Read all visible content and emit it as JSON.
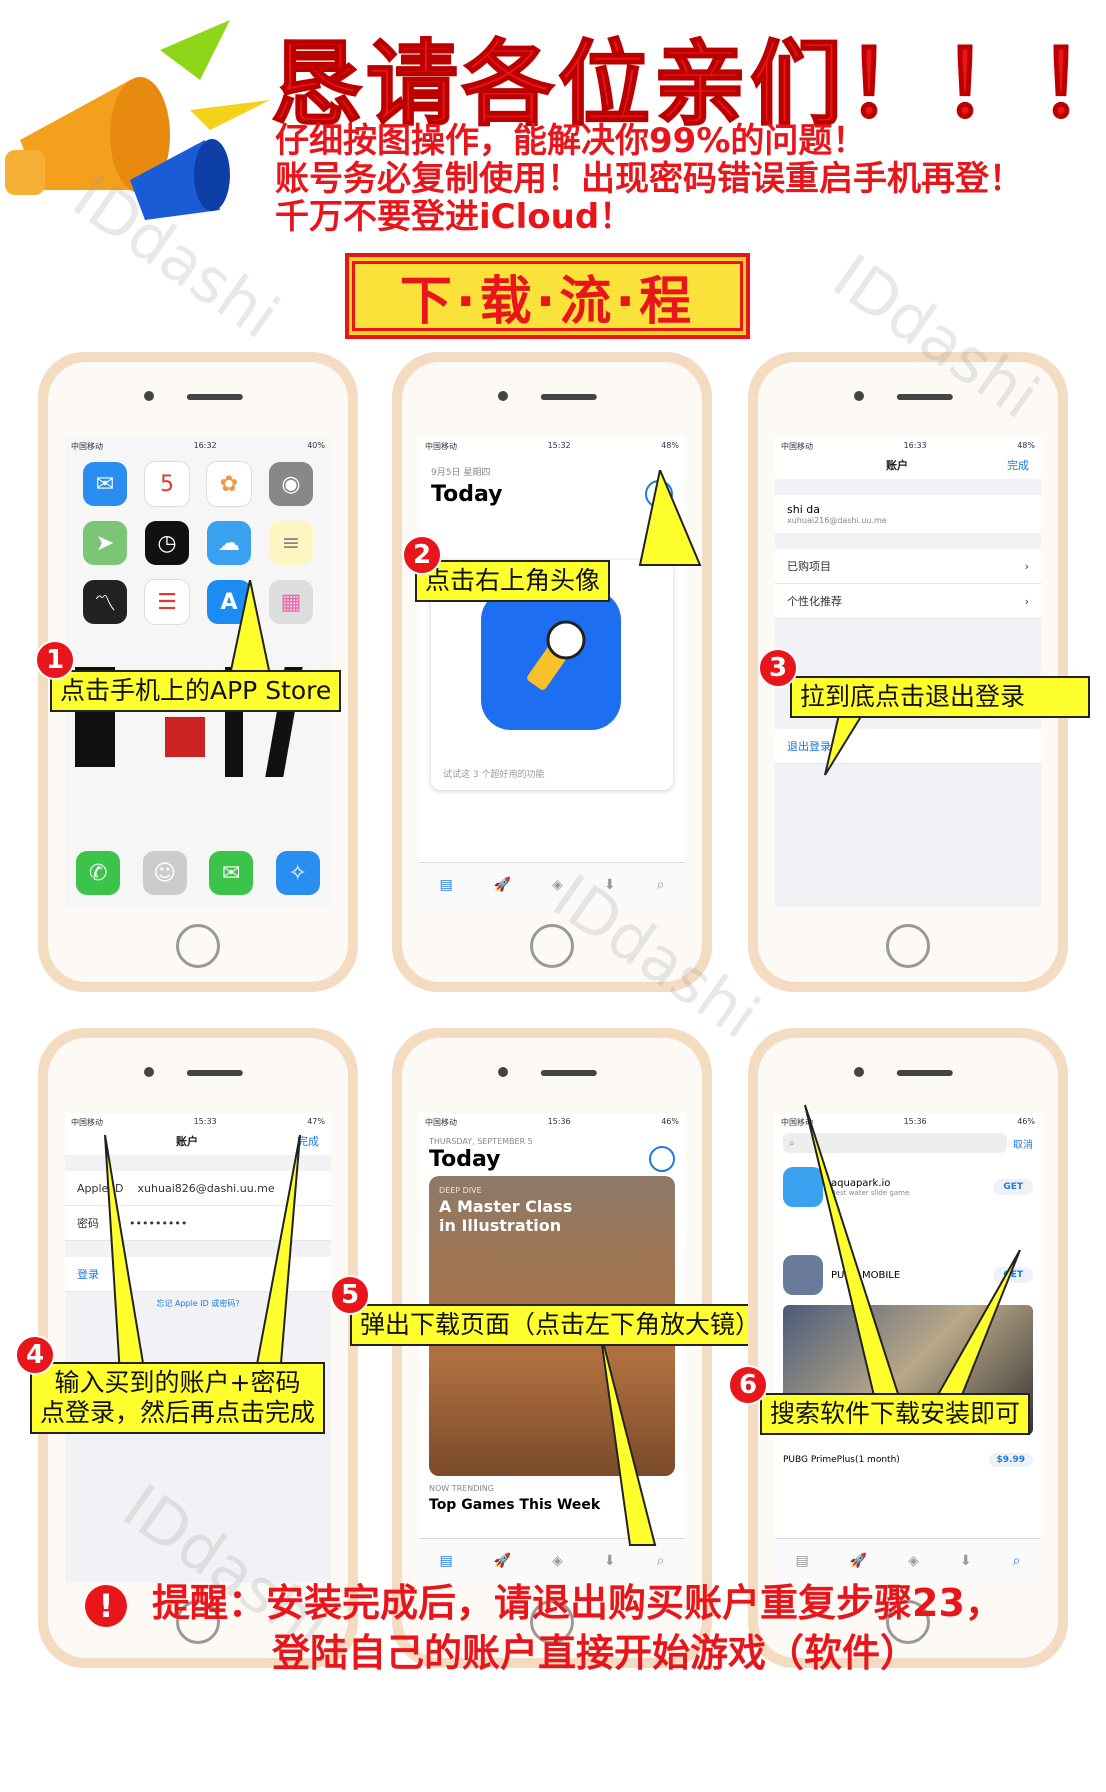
{
  "header": {
    "headline": "恳请各位亲们！！！",
    "lines": [
      "仔细按图操作，能解决你99%的问题！",
      "账号务必复制使用！出现密码错误重启手机再登！",
      "千万不要登进iCloud！"
    ],
    "flow_title": "下·载·流·程"
  },
  "watermark": "IDdashi",
  "steps": [
    {
      "num": "1",
      "text": "点击手机上的APP Store"
    },
    {
      "num": "2",
      "text": "点击右上角头像"
    },
    {
      "num": "3",
      "text": "拉到底点击退出登录"
    },
    {
      "num": "4",
      "text_line1": "输入买到的账户+密码",
      "text_line2": "点登录，然后再点击完成"
    },
    {
      "num": "5",
      "text": "弹出下载页面（点击左下角放大镜）"
    },
    {
      "num": "6",
      "text": "搜索软件下载安装即可"
    }
  ],
  "screens": {
    "s2": {
      "date": "9月5日 星期四",
      "title": "Today",
      "card_label": "试试这 3 个超好用的功能"
    },
    "s3": {
      "nav_title": "账户",
      "done": "完成",
      "name": "shi da",
      "email": "xuhuai216@dashi.uu.me",
      "row1": "已购项目",
      "row2": "个性化推荐",
      "logout": "退出登录"
    },
    "s4": {
      "nav_title": "账户",
      "done": "完成",
      "apple_id_label": "Apple ID",
      "apple_id_value": "xuhuai826@dashi.uu.me",
      "pwd_label": "密码",
      "pwd_value": "•••••••••",
      "login": "登录",
      "forgot": "忘记 Apple ID 或密码?"
    },
    "s5": {
      "date": "THURSDAY, SEPTEMBER 5",
      "title": "Today",
      "card_tag": "DEEP DIVE",
      "card_title": "A Master Class in Illustration",
      "trending": "NOW TRENDING",
      "trending_title": "Top Games This Week"
    },
    "s6": {
      "cancel": "取消",
      "app1": "aquapark.io",
      "app1_sub": "Best water slide game",
      "app2": "PUBG MOBILE",
      "get": "GET",
      "iap": "PUBG PrimePlus(1 month)",
      "price": "$9.99"
    }
  },
  "footer": {
    "line1": "提醒：安装完成后，请退出购买账户重复步骤23，",
    "line2": "登陆自己的账户直接开始游戏（软件）"
  },
  "colors": {
    "red": "#e8161b",
    "yellow": "#ffff2e",
    "blue": "#1f7ae0"
  }
}
